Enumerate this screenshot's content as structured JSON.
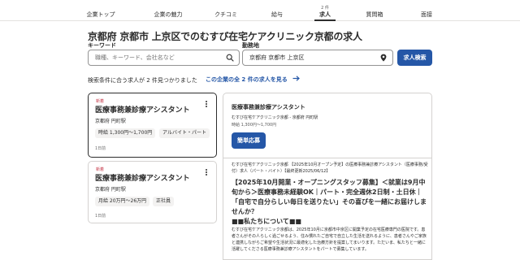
{
  "nav": {
    "items": [
      {
        "label": "企業トップ"
      },
      {
        "label": "企業の魅力"
      },
      {
        "label": "クチコミ"
      },
      {
        "label": "給与"
      },
      {
        "label": "求人",
        "badge": "2 件"
      },
      {
        "label": "質問箱"
      },
      {
        "label": "面接"
      }
    ]
  },
  "page": {
    "title": "京都府 京都市 上京区でのむすび在宅ケアクリニック京都の求人"
  },
  "search": {
    "keyword_label": "キーワード",
    "keyword_placeholder": "職種、キーワード、会社名など",
    "location_label": "勤務地",
    "location_value": "京都府 京都市 上京区",
    "button_label": "求人検索",
    "search_icon": "search-icon",
    "location_icon": "location-pin-icon"
  },
  "results": {
    "count_text": "検索条件に合う求人が 2 件見つかりました",
    "all_link": "この企業の全 2 件の求人を見る"
  },
  "jobs": [
    {
      "tag": "新着",
      "title": "医療事務兼診療アシスタント",
      "location": "京都府 円町駅",
      "chips": [
        "時給 1,300円～1,700円",
        "アルバイト・パート"
      ],
      "date": "1日前"
    },
    {
      "tag": "新着",
      "title": "医療事務兼診療アシスタント",
      "location": "京都府 円町駅",
      "chips": [
        "月給 20万円～26万円",
        "正社員"
      ],
      "date": "1日前"
    }
  ],
  "detail": {
    "title": "医療事務兼診療アシスタント",
    "company": "むすび在宅ケアクリニック京都 - 京都府 円町駅",
    "salary": "時給 1,300円～1,700円",
    "apply_label": "簡単応募",
    "meta": "むすび在宅ケアクリニック京都 【2025年10月オープン予定】の医療事務兼診療アシスタント（医療事務/受付）求人（パート・バイト）【最終更新2025/06/12】",
    "headline": "【2025年10月開業・オープニングスタッフ募集】＜就業は9月中旬から＞医療事務未経験OK｜パート・完全週休2日制・土日休｜「自宅で自分らしい毎日を送りたい」その喜びを一緒にお届けしませんか？",
    "section": "■■私たちについて■■",
    "body": "むすび在宅ケアクリニック京都は、2025年10月に京都市中京区に開業予定の在宅医療専門の医院です。患者さんがその人らしく過ごせるよう、住み慣れたご自宅で自立した生活を送れるように、患者さんやご家族と連携しながらご希望や生活状況に最適化した治療方針を提案してまいります。ただいま、私たちと一緒に活躍してくださる医療事務兼診療アシスタントをパートで募集しています。"
  },
  "colors": {
    "primary": "#2557a7",
    "new_tag": "#c6394a",
    "text": "#2d2d2d",
    "chip_bg": "#f3f2f1"
  }
}
